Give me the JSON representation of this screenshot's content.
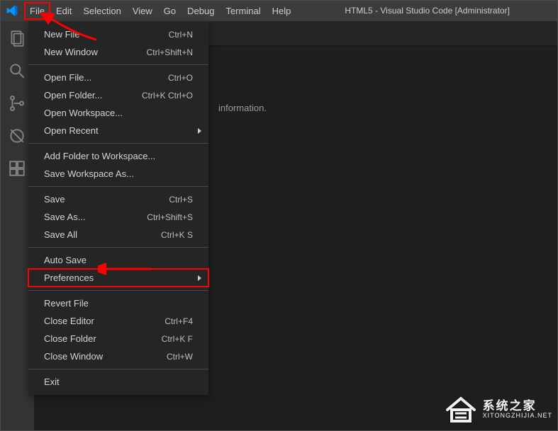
{
  "title": "HTML5 - Visual Studio Code [Administrator]",
  "menu": {
    "file": "File",
    "edit": "Edit",
    "selection": "Selection",
    "view": "View",
    "go": "Go",
    "debug": "Debug",
    "terminal": "Terminal",
    "help": "Help"
  },
  "content": {
    "info_suffix": "information."
  },
  "dropdown": {
    "new_file": "New File",
    "new_file_k": "Ctrl+N",
    "new_window": "New Window",
    "new_window_k": "Ctrl+Shift+N",
    "open_file": "Open File...",
    "open_file_k": "Ctrl+O",
    "open_folder": "Open Folder...",
    "open_folder_k": "Ctrl+K Ctrl+O",
    "open_workspace": "Open Workspace...",
    "open_recent": "Open Recent",
    "add_folder": "Add Folder to Workspace...",
    "save_workspace_as": "Save Workspace As...",
    "save": "Save",
    "save_k": "Ctrl+S",
    "save_as": "Save As...",
    "save_as_k": "Ctrl+Shift+S",
    "save_all": "Save All",
    "save_all_k": "Ctrl+K S",
    "auto_save": "Auto Save",
    "preferences": "Preferences",
    "revert_file": "Revert File",
    "close_editor": "Close Editor",
    "close_editor_k": "Ctrl+F4",
    "close_folder": "Close Folder",
    "close_folder_k": "Ctrl+K F",
    "close_window": "Close Window",
    "close_window_k": "Ctrl+W",
    "exit": "Exit"
  },
  "watermark": {
    "cn": "系统之家",
    "en": "XITONGZHIJIA.NET"
  }
}
